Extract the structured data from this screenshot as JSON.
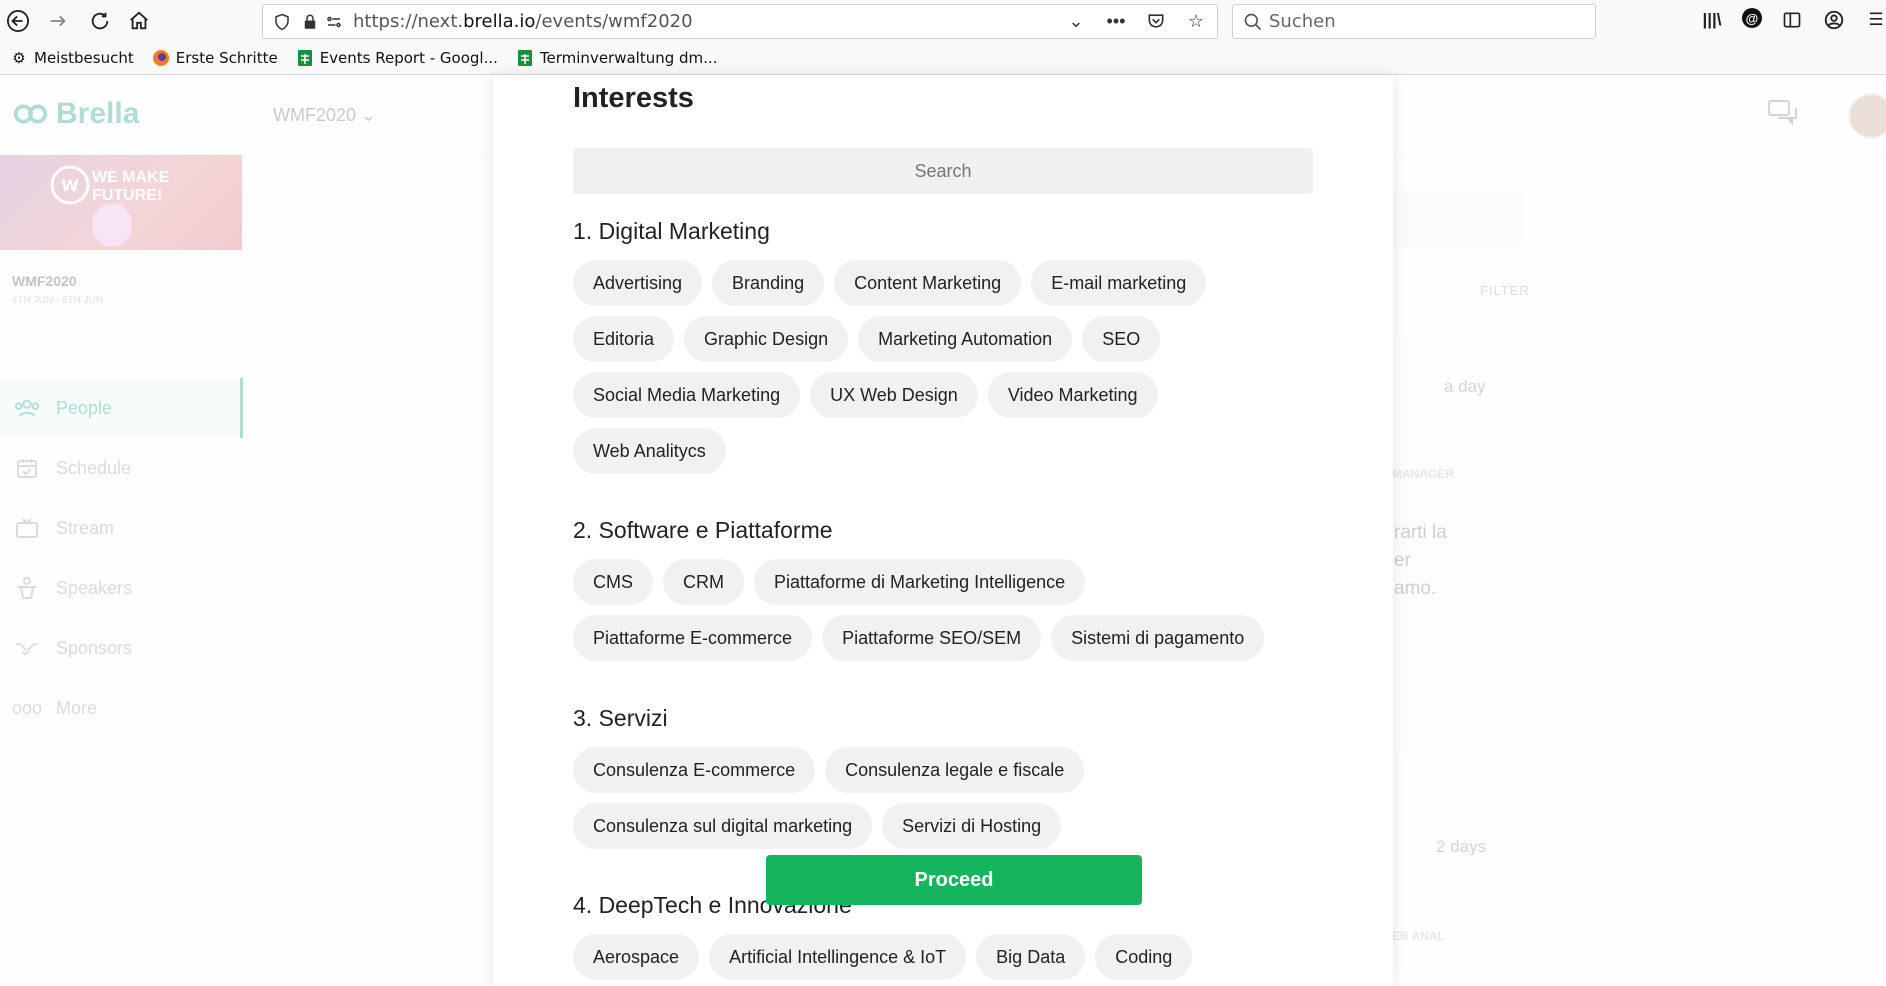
{
  "browser": {
    "url_prefix": "https://next.",
    "url_host": "brella.io",
    "url_path": "/events/wmf2020",
    "search_placeholder": "Suchen",
    "bookmarks": [
      {
        "label": "Meistbesucht",
        "icon": "gear-icon"
      },
      {
        "label": "Erste Schritte",
        "icon": "firefox-icon"
      },
      {
        "label": "Events Report - Googl...",
        "icon": "google-sheets-icon"
      },
      {
        "label": "Terminverwaltung dm...",
        "icon": "google-sheets-icon"
      }
    ]
  },
  "app": {
    "logo": "Brella",
    "event_selector": "WMF2020",
    "banner_text_line1": "WE MAKE",
    "banner_text_line2": "FUTURE!",
    "event_name": "WMF2020",
    "event_dates": "4TH JUN - 6TH JUN",
    "nav": [
      {
        "label": "People",
        "icon": "people-icon",
        "active": true
      },
      {
        "label": "Schedule",
        "icon": "calendar-icon",
        "active": false
      },
      {
        "label": "Stream",
        "icon": "tv-icon",
        "active": false
      },
      {
        "label": "Speakers",
        "icon": "podium-icon",
        "active": false
      },
      {
        "label": "Sponsors",
        "icon": "handshake-icon",
        "active": false
      },
      {
        "label": "More",
        "icon": "more-icon",
        "active": false
      }
    ],
    "background": {
      "filter": "FILTER",
      "time1": "a day",
      "tag1": "MANAGER",
      "text_line1": "rarti la",
      "text_line2": "er",
      "text_line3": "amo.",
      "time2": "2 days",
      "tag2": "EB ANAL"
    }
  },
  "modal": {
    "title": "Interests",
    "search_placeholder": "Search",
    "sections": [
      {
        "title": "1. Digital Marketing",
        "items": [
          "Advertising",
          "Branding",
          "Content Marketing",
          "E-mail marketing",
          "Editoria",
          "Graphic Design",
          "Marketing Automation",
          "SEO",
          "Social Media Marketing",
          "UX Web Design",
          "Video Marketing",
          "Web Analitycs"
        ]
      },
      {
        "title": "2. Software e Piattaforme",
        "items": [
          "CMS",
          "CRM",
          "Piattaforme di Marketing Intelligence",
          "Piattaforme E-commerce",
          "Piattaforme SEO/SEM",
          "Sistemi di pagamento"
        ]
      },
      {
        "title": "3. Servizi",
        "items": [
          "Consulenza E-commerce",
          "Consulenza legale e fiscale",
          "Consulenza sul digital marketing",
          "Servizi di Hosting"
        ]
      },
      {
        "title": "4. DeepTech e Innovazione",
        "items": [
          "Aerospace",
          "Artificial Intellingence & IoT",
          "Big Data",
          "Coding"
        ]
      }
    ],
    "proceed_label": "Proceed",
    "accent_color": "#15b55d"
  }
}
